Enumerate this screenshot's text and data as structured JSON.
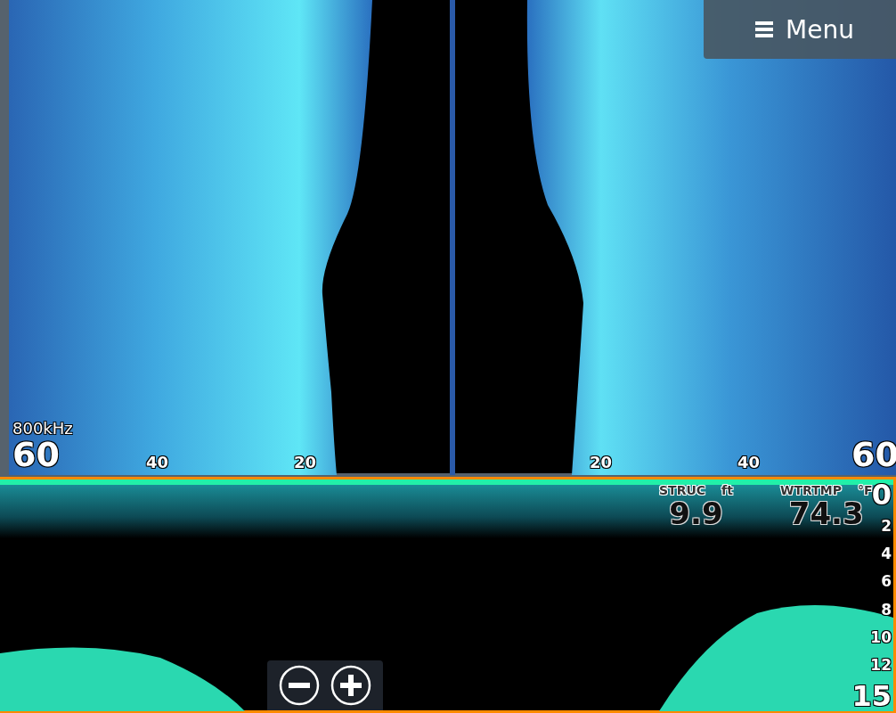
{
  "menu_button": {
    "label": "Menu"
  },
  "side_scan": {
    "frequency": "800kHz",
    "range_labels": [
      "60",
      "40",
      "20",
      "20",
      "40",
      "60"
    ]
  },
  "readouts": [
    {
      "label": "STRUC",
      "unit": "ft",
      "value": "9.9"
    },
    {
      "label": "WTRTMP",
      "unit": "°F",
      "value": "74.3"
    }
  ],
  "down_scan": {
    "depth_scale": [
      "0",
      "2",
      "4",
      "6",
      "8",
      "10",
      "12",
      "15"
    ]
  }
}
